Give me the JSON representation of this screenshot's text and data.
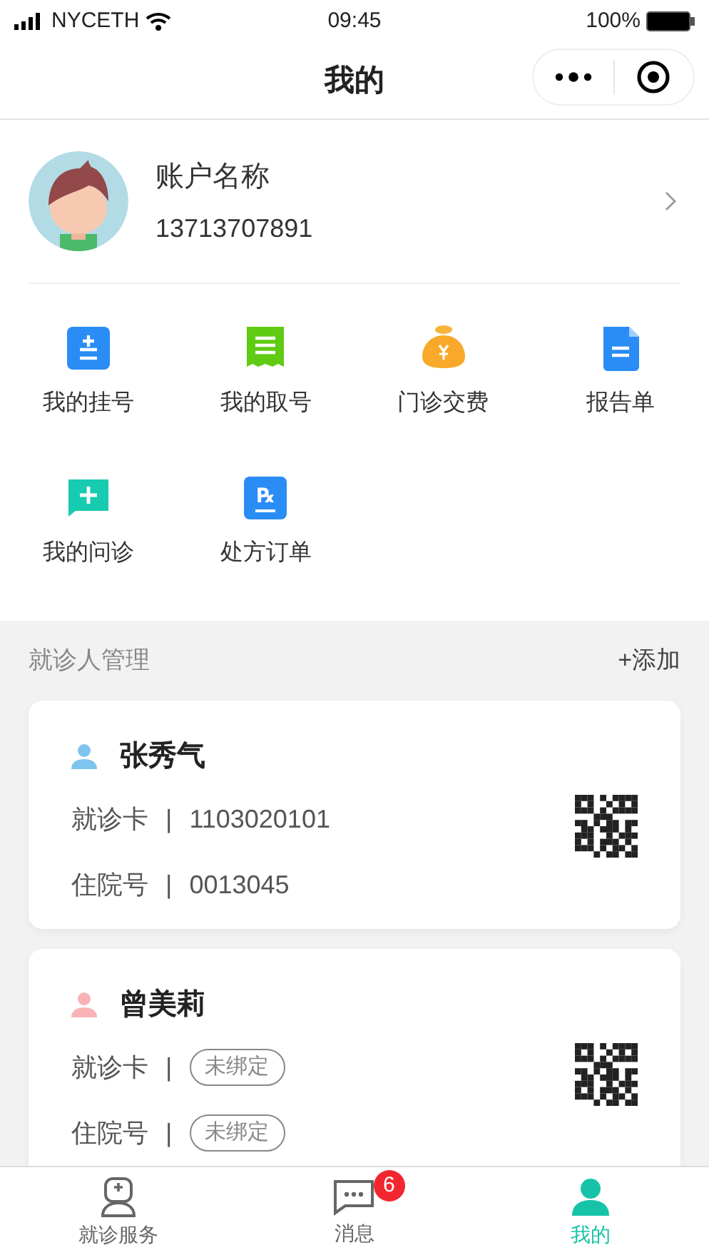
{
  "status_bar": {
    "carrier": "NYCETH",
    "time": "09:45",
    "battery": "100%"
  },
  "nav": {
    "title": "我的"
  },
  "profile": {
    "name": "账户名称",
    "phone": "13713707891"
  },
  "menu": [
    {
      "label": "我的挂号"
    },
    {
      "label": "我的取号"
    },
    {
      "label": "门诊交费"
    },
    {
      "label": "报告单"
    },
    {
      "label": "我的问诊"
    },
    {
      "label": "处方订单",
      "icon_label": "℞"
    }
  ],
  "patients_section": {
    "title": "就诊人管理",
    "add": "+添加"
  },
  "patients": [
    {
      "name": "张秀气",
      "color": "#7ec4ee",
      "fields": [
        {
          "label": "就诊卡",
          "separator": "|",
          "kind": "value",
          "value": "1103020101"
        },
        {
          "label": "住院号",
          "separator": "|",
          "kind": "value",
          "value": "0013045"
        }
      ]
    },
    {
      "name": "曾美莉",
      "color": "#f7b3b5",
      "fields": [
        {
          "label": "就诊卡",
          "separator": "|",
          "kind": "tag",
          "value": "未绑定"
        },
        {
          "label": "住院号",
          "separator": "|",
          "kind": "tag",
          "value": "未绑定"
        }
      ]
    }
  ],
  "tab_bar": [
    {
      "label": "就诊服务",
      "selected": false
    },
    {
      "label": "消息",
      "selected": false,
      "badge": "6"
    },
    {
      "label": "我的",
      "selected": true
    }
  ]
}
